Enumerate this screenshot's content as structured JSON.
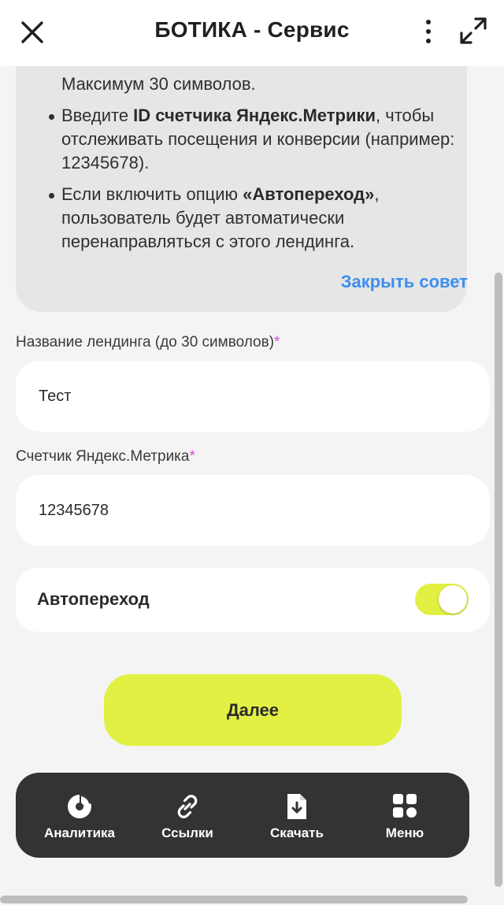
{
  "header": {
    "title": "БОТИКА - Сервис",
    "close_icon": "close-icon",
    "more_icon": "more-vertical-icon",
    "expand_icon": "expand-icon"
  },
  "tip": {
    "partial_line": "Максимум 30 символов.",
    "item2_pre": "Введите ",
    "item2_bold": "ID счетчика Яндекс.Метрики",
    "item2_post": ", чтобы отслеживать посещения и конверсии (например: 12345678).",
    "item3_pre": "Если включить опцию ",
    "item3_bold": "«Автопереход»",
    "item3_post": ", пользователь будет автоматически перенаправляться с этого лендинга.",
    "close_label": "Закрыть совет"
  },
  "form": {
    "name_label": "Название лендинга (до 30 символов)",
    "name_value": "Тест",
    "metrika_label": "Счетчик Яндекс.Метрика",
    "metrika_value": "12345678",
    "required_mark": "*",
    "autoswitch_label": "Автопереход",
    "autoswitch_on": true
  },
  "next_label": "Далее",
  "nav": {
    "items": [
      {
        "label": "Аналитика",
        "icon": "pie-chart-icon"
      },
      {
        "label": "Ссылки",
        "icon": "link-icon"
      },
      {
        "label": "Скачать",
        "icon": "download-file-icon"
      },
      {
        "label": "Меню",
        "icon": "grid-menu-icon"
      }
    ]
  },
  "colors": {
    "accent": "#e2f044",
    "link": "#3c8ef0",
    "required": "#d74fd0",
    "nav_bg": "#333333"
  }
}
